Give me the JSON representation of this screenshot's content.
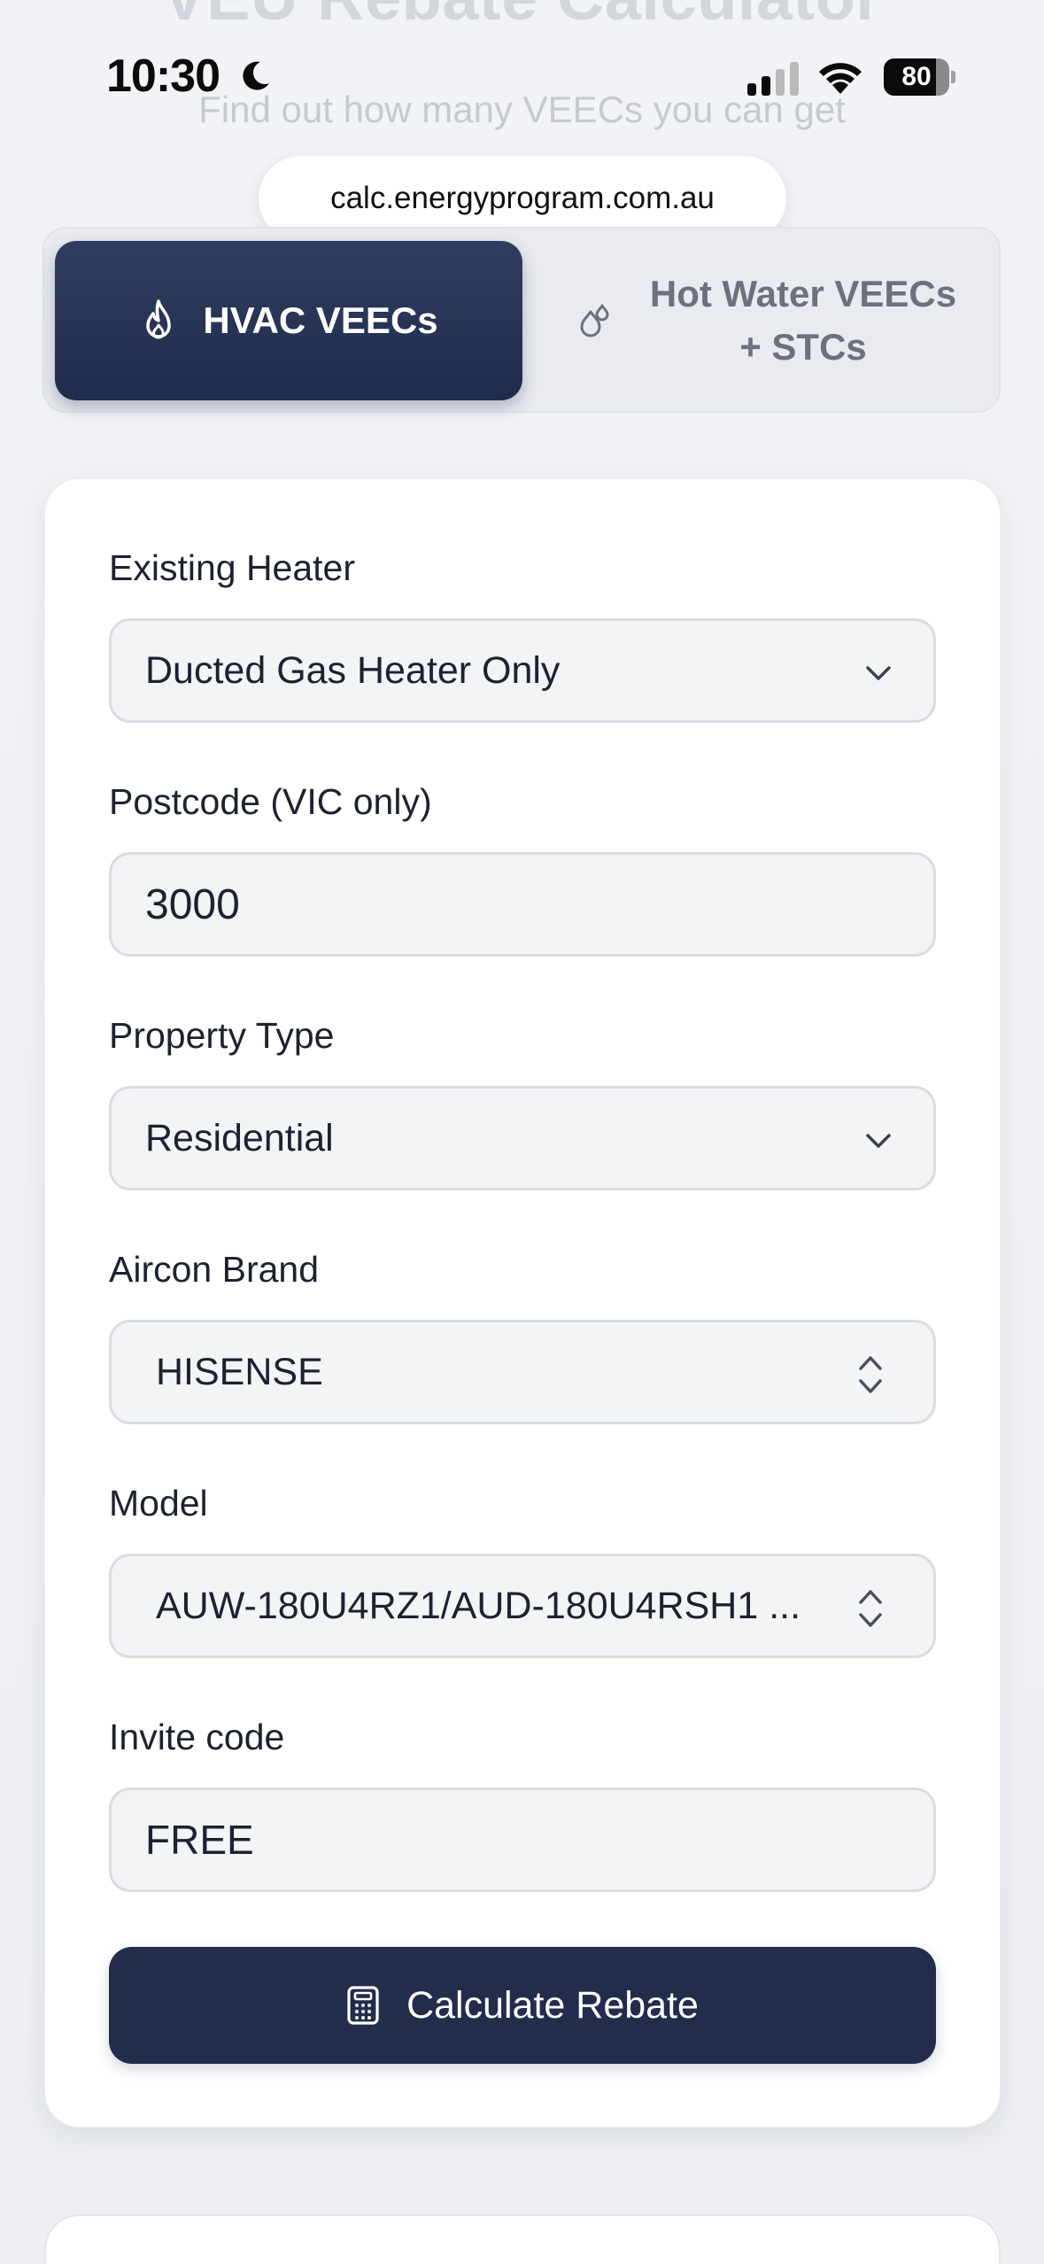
{
  "page": {
    "title": "VEU Rebate Calculator",
    "subtitle": "Find out how many VEECs you can get"
  },
  "status_bar": {
    "time": "10:30",
    "battery_level": "80",
    "battery_fraction": 0.8
  },
  "browser": {
    "url": "calc.energyprogram.com.au"
  },
  "tabs": [
    {
      "label": "HVAC VEECs",
      "icon": "flame-icon",
      "active": true
    },
    {
      "label": "Hot Water VEECs + STCs",
      "icon": "water-drops-icon",
      "active": false
    }
  ],
  "form": {
    "existing_heater": {
      "label": "Existing Heater",
      "value": "Ducted Gas Heater Only"
    },
    "postcode": {
      "label": "Postcode (VIC only)",
      "value": "3000"
    },
    "property_type": {
      "label": "Property Type",
      "value": "Residential"
    },
    "aircon_brand": {
      "label": "Aircon Brand",
      "value": "HISENSE"
    },
    "model": {
      "label": "Model",
      "value": "AUW-180U4RZ1/AUD-180U4RSH1 ..."
    },
    "invite_code": {
      "label": "Invite code",
      "value": "FREE"
    },
    "submit_label": "Calculate Rebate"
  },
  "colors": {
    "primary_navy": "#222c4b",
    "page_background": "#eef0f4",
    "field_background": "#f3f4f6",
    "field_border": "#d9dce2"
  }
}
